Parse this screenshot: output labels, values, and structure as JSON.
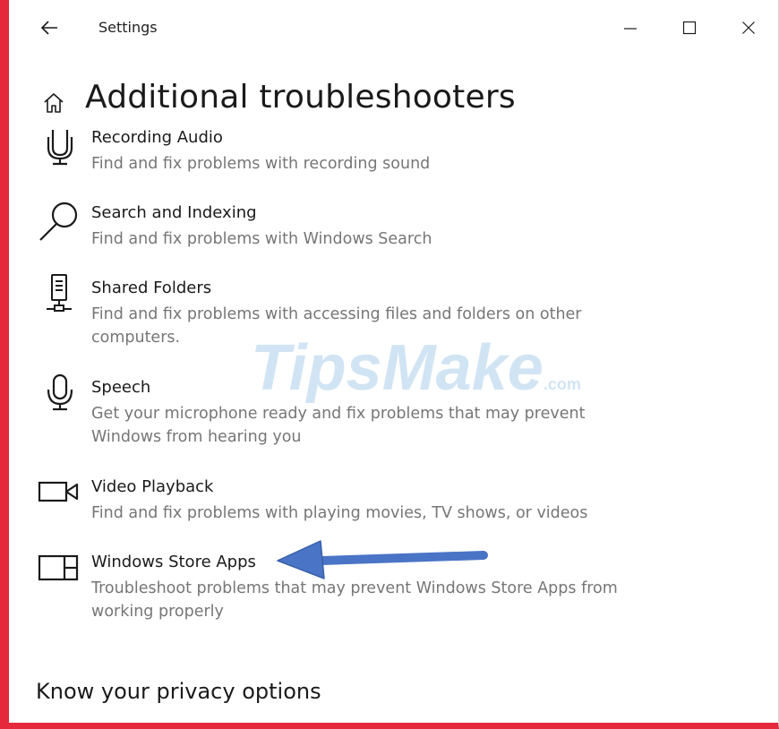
{
  "window": {
    "app_title": "Settings"
  },
  "page": {
    "title": "Additional troubleshooters"
  },
  "troubleshooters": [
    {
      "title": "Recording Audio",
      "description": "Find and fix problems with recording sound",
      "icon": "microphone-icon"
    },
    {
      "title": "Search and Indexing",
      "description": "Find and fix problems with Windows Search",
      "icon": "search-icon"
    },
    {
      "title": "Shared Folders",
      "description": "Find and fix problems with accessing files and folders on other computers.",
      "icon": "network-drive-icon"
    },
    {
      "title": "Speech",
      "description": "Get your microphone ready and fix problems that may prevent Windows from hearing you",
      "icon": "headset-microphone-icon"
    },
    {
      "title": "Video Playback",
      "description": "Find and fix problems with playing movies, TV shows, or videos",
      "icon": "video-camera-icon"
    },
    {
      "title": "Windows Store Apps",
      "description": "Troubleshoot problems that may prevent Windows Store Apps from working properly",
      "icon": "store-apps-icon"
    }
  ],
  "privacy": {
    "heading": "Know your privacy options"
  },
  "watermark": {
    "text": "TipsMake",
    "suffix": ".com"
  },
  "colors": {
    "accent_border": "#e5283b",
    "description_text": "#767676",
    "arrow": "#4a74c6"
  }
}
